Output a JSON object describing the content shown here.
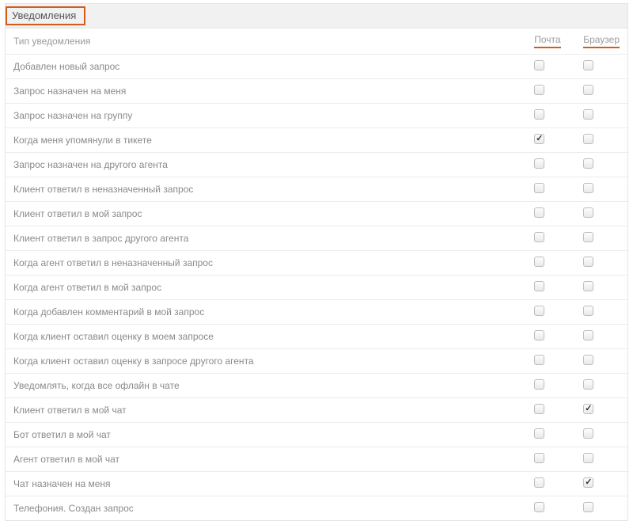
{
  "panel": {
    "title": "Уведомления"
  },
  "columns": {
    "type": "Тип уведомления",
    "mail": "Почта",
    "browser": "Браузер"
  },
  "rows": [
    {
      "label": "Добавлен новый запрос",
      "mail": false,
      "browser": false
    },
    {
      "label": "Запрос назначен на меня",
      "mail": false,
      "browser": false
    },
    {
      "label": "Запрос назначен на группу",
      "mail": false,
      "browser": false
    },
    {
      "label": "Когда меня упомянули в тикете",
      "mail": true,
      "browser": false
    },
    {
      "label": "Запрос назначен на другого агента",
      "mail": false,
      "browser": false
    },
    {
      "label": "Клиент ответил в неназначенный запрос",
      "mail": false,
      "browser": false
    },
    {
      "label": "Клиент ответил в мой запрос",
      "mail": false,
      "browser": false
    },
    {
      "label": "Клиент ответил в запрос другого агента",
      "mail": false,
      "browser": false
    },
    {
      "label": "Когда агент ответил в неназначенный запрос",
      "mail": false,
      "browser": false
    },
    {
      "label": "Когда агент ответил в мой запрос",
      "mail": false,
      "browser": false
    },
    {
      "label": "Когда добавлен комментарий в мой запрос",
      "mail": false,
      "browser": false
    },
    {
      "label": "Когда клиент оставил оценку в моем запросе",
      "mail": false,
      "browser": false
    },
    {
      "label": "Когда клиент оставил оценку в запросе другого агента",
      "mail": false,
      "browser": false
    },
    {
      "label": "Уведомлять, когда все офлайн в чате",
      "mail": false,
      "browser": false
    },
    {
      "label": "Клиент ответил в мой чат",
      "mail": false,
      "browser": true
    },
    {
      "label": "Бот ответил в мой чат",
      "mail": false,
      "browser": false
    },
    {
      "label": "Агент ответил в мой чат",
      "mail": false,
      "browser": false
    },
    {
      "label": "Чат назначен на меня",
      "mail": false,
      "browser": true
    },
    {
      "label": "Телефония. Создан запрос",
      "mail": false,
      "browser": false
    }
  ]
}
